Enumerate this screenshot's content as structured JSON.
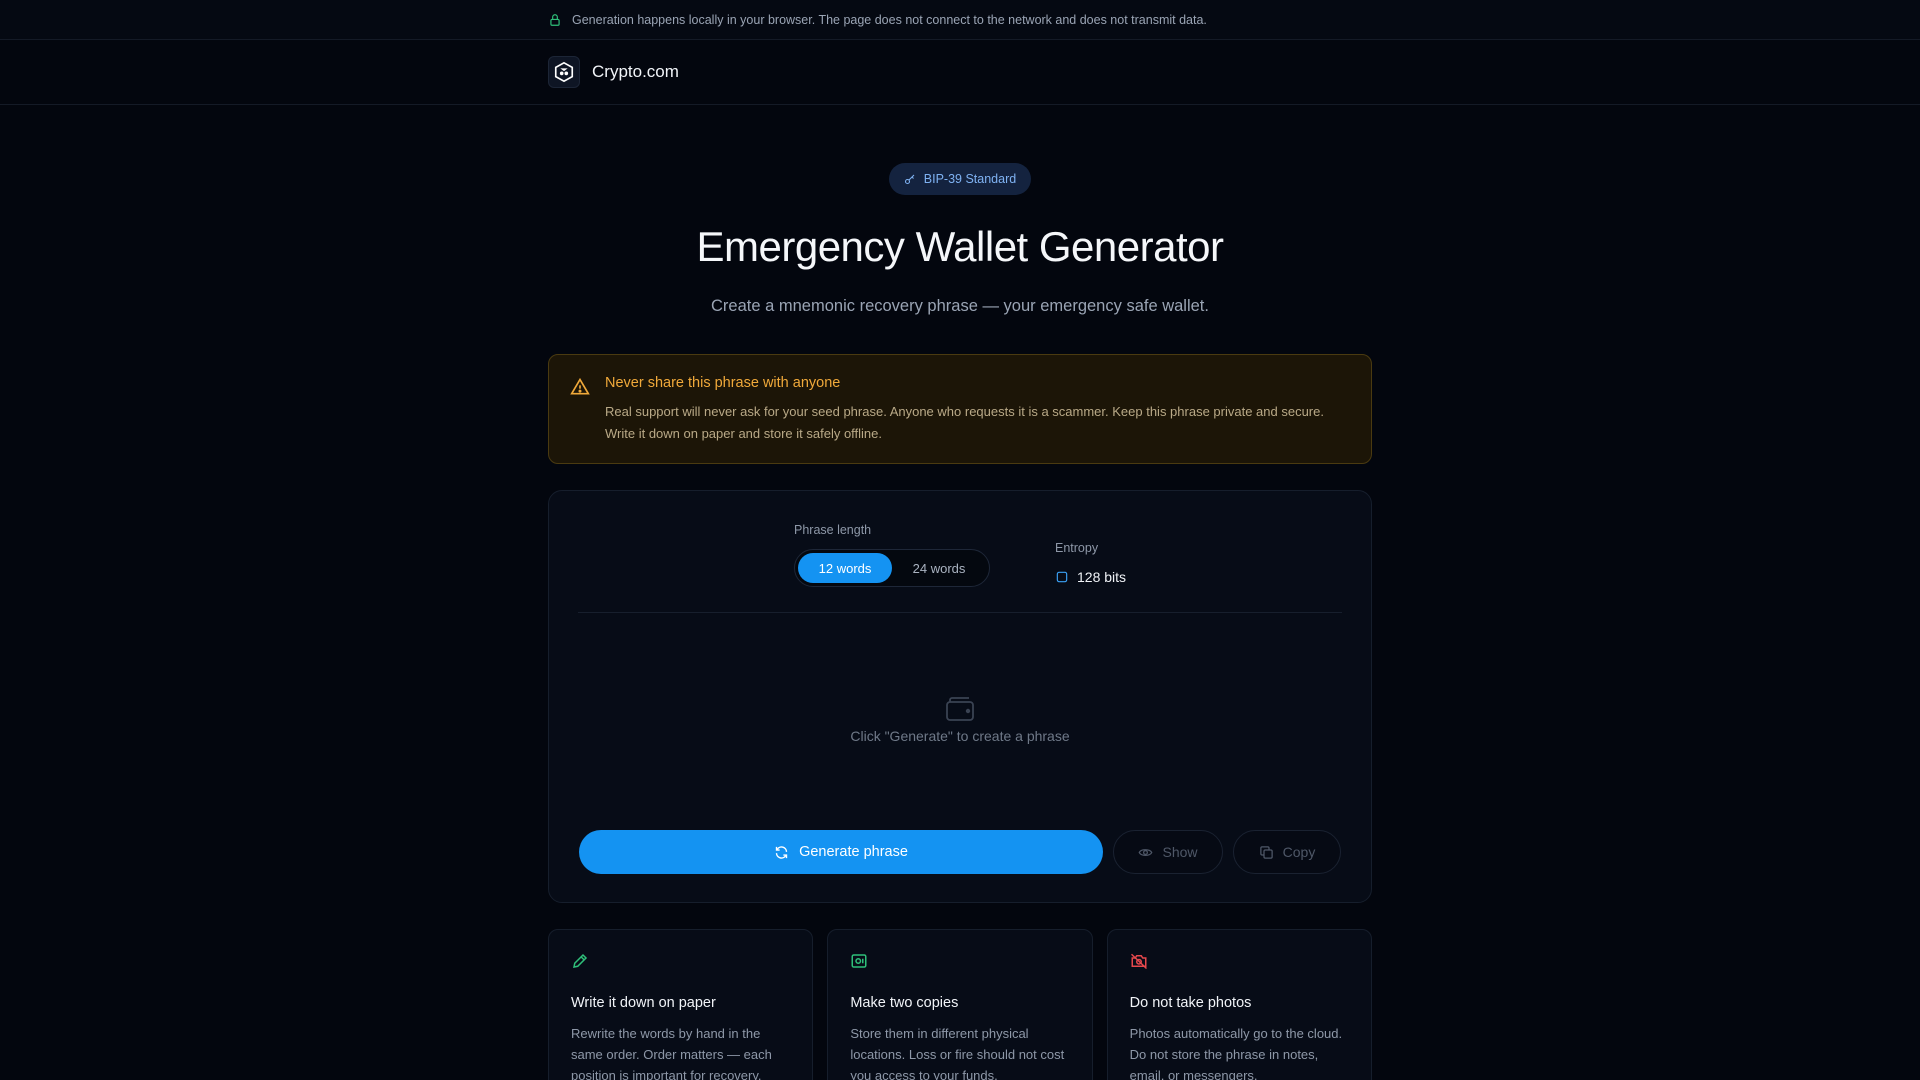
{
  "topbar": {
    "notice": "Generation happens locally in your browser. The page does not connect to the network and does not transmit data."
  },
  "header": {
    "brand": "Crypto.com"
  },
  "hero": {
    "badge": "BIP-39 Standard",
    "title": "Emergency Wallet Generator",
    "subtitle": "Create a mnemonic recovery phrase — your emergency safe wallet."
  },
  "warning": {
    "title": "Never share this phrase with anyone",
    "text": "Real support will never ask for your seed phrase. Anyone who requests it is a scammer. Keep this phrase private and secure. Write it down on paper and store it safely offline."
  },
  "generator": {
    "length_label": "Phrase length",
    "options": [
      "12 words",
      "24 words"
    ],
    "selected": "12 words",
    "entropy_label": "Entropy",
    "entropy_value": "128 bits",
    "empty_hint": "Click \"Generate\" to create a phrase",
    "generate_label": "Generate phrase",
    "show_label": "Show",
    "copy_label": "Copy"
  },
  "tips": [
    {
      "title": "Write it down on paper",
      "text": "Rewrite the words by hand in the same order. Order matters — each position is important for recovery.",
      "icon": "pencil-icon",
      "color": "#2fc07a"
    },
    {
      "title": "Make two copies",
      "text": "Store them in different physical locations. Loss or fire should not cost you access to your funds.",
      "icon": "safe-icon",
      "color": "#2fc07a"
    },
    {
      "title": "Do not take photos",
      "text": "Photos automatically go to the cloud. Do not store the phrase in notes, email, or messengers.",
      "icon": "no-camera-icon",
      "color": "#e5484d"
    }
  ]
}
